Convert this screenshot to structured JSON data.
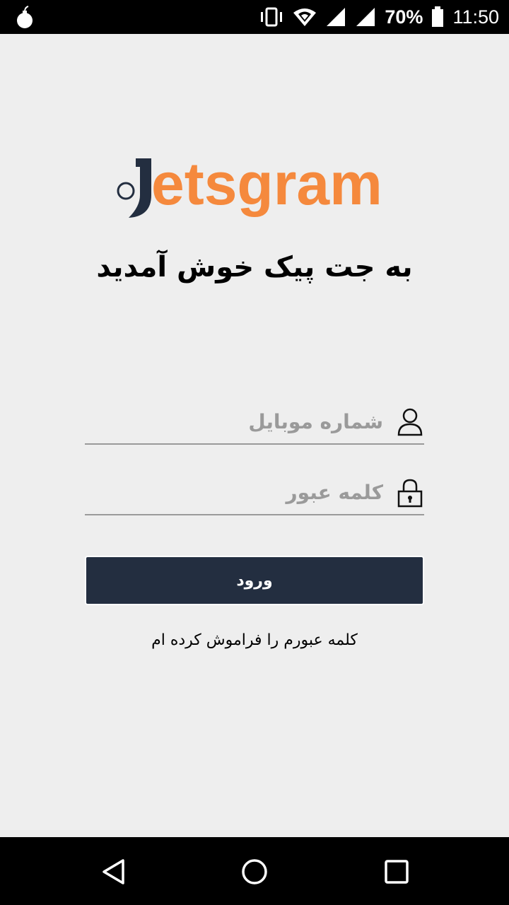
{
  "status_bar": {
    "battery_level": "70%",
    "time": "11:50",
    "icons": [
      "bomb-icon",
      "vibrate-icon",
      "wifi-icon",
      "signal-icon",
      "signal-icon",
      "battery-icon"
    ]
  },
  "logo": {
    "wordmark": "etsgram",
    "mark": "J-mark"
  },
  "welcome_title": "به جت پیک خوش آمدید",
  "form": {
    "mobile": {
      "placeholder": "شماره موبایل",
      "value": "",
      "icon": "user-icon"
    },
    "password": {
      "placeholder": "کلمه عبور",
      "value": "",
      "icon": "lock-icon"
    },
    "login_label": "ورود",
    "forgot_label": "کلمه عبورم را فراموش کرده ام"
  },
  "colors": {
    "brand_orange": "#f5893d",
    "brand_navy": "#232e40",
    "background": "#eeeeee"
  },
  "nav_bar": {
    "icons": [
      "back-icon",
      "home-icon",
      "recents-icon"
    ]
  }
}
